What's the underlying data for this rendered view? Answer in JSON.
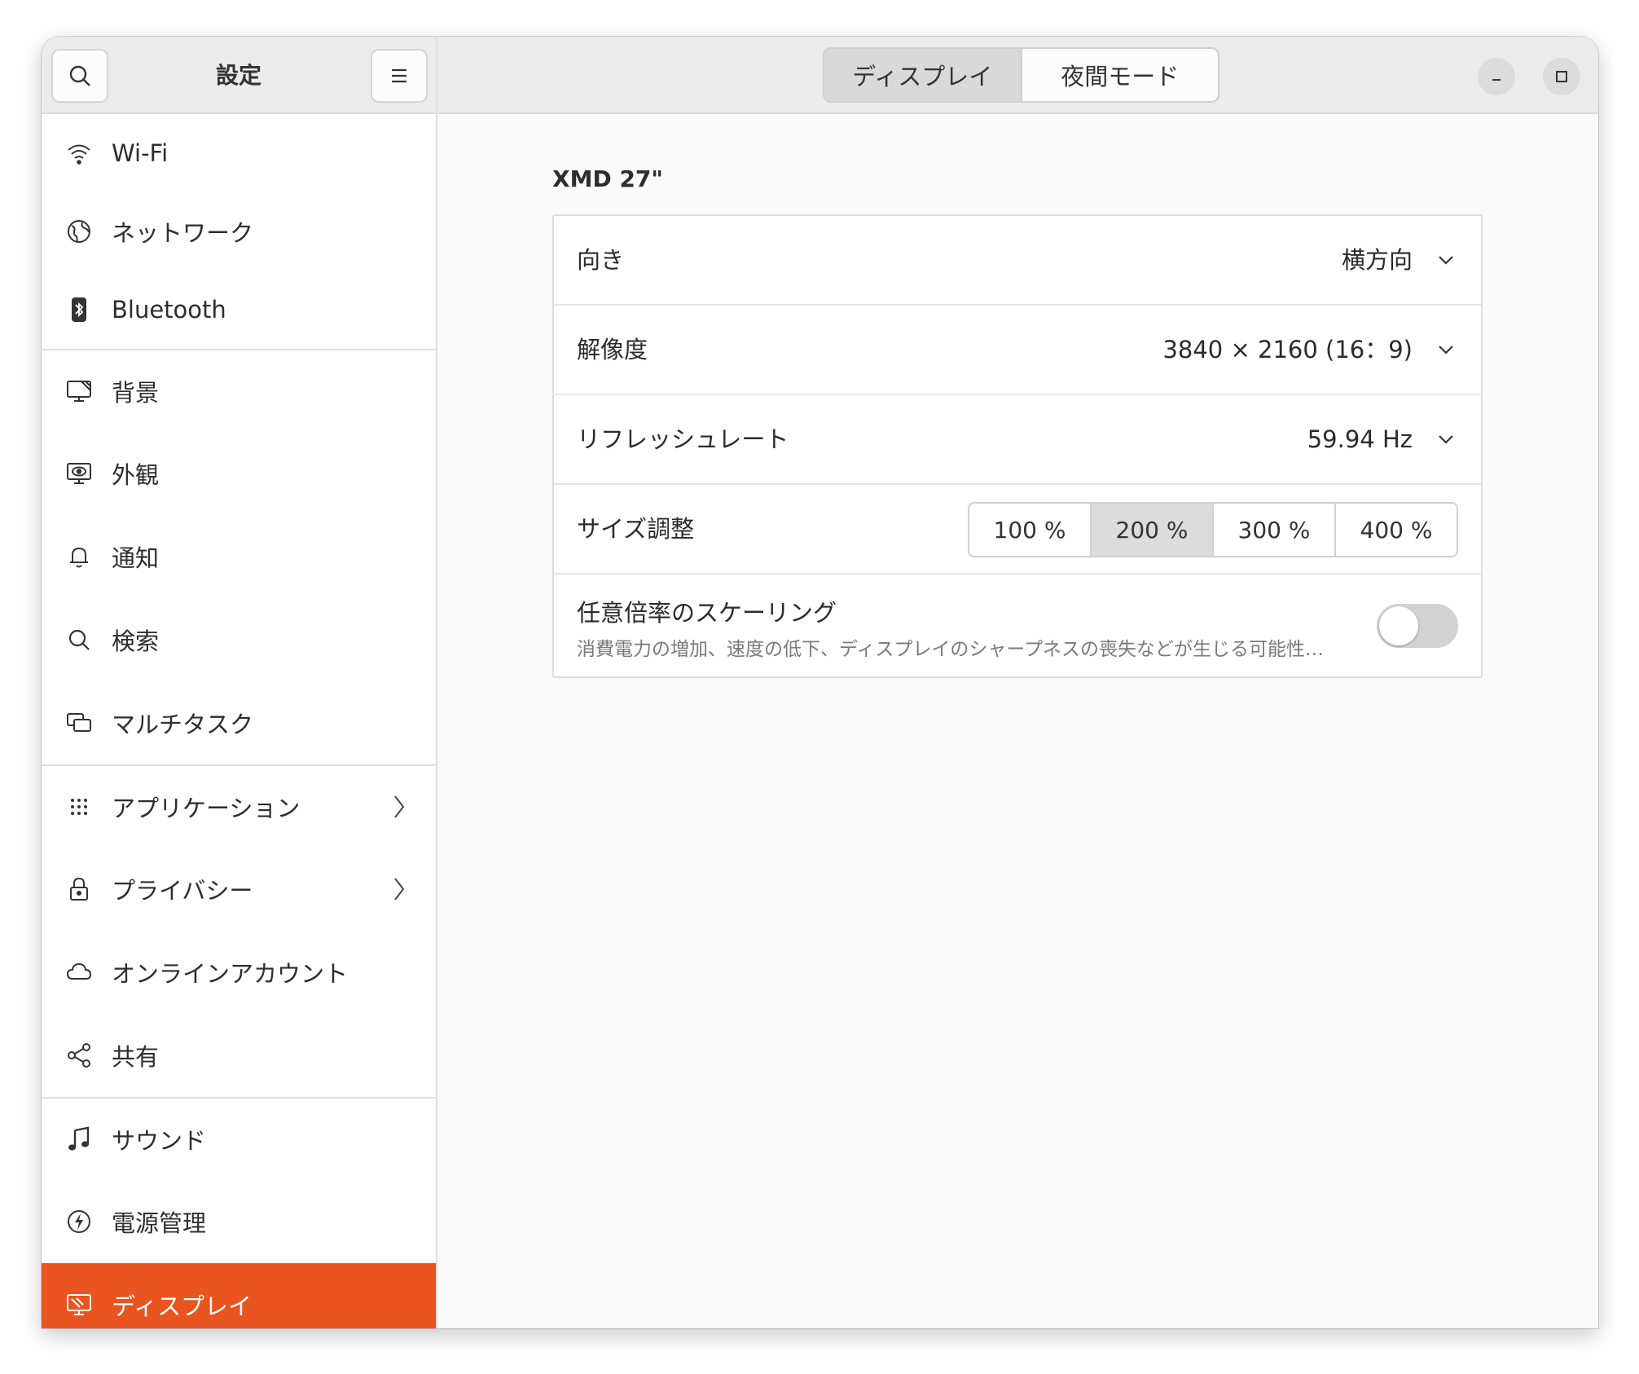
{
  "sidebar": {
    "title": "設定",
    "items": [
      {
        "label": "Wi-Fi",
        "icon": "wifi-icon"
      },
      {
        "label": "ネットワーク",
        "icon": "globe-icon"
      },
      {
        "label": "Bluetooth",
        "icon": "bluetooth-icon"
      },
      {
        "label": "背景",
        "icon": "monitor-background-icon"
      },
      {
        "label": "外観",
        "icon": "appearance-icon"
      },
      {
        "label": "通知",
        "icon": "bell-icon"
      },
      {
        "label": "検索",
        "icon": "search-icon"
      },
      {
        "label": "マルチタスク",
        "icon": "multitask-icon"
      },
      {
        "label": "アプリケーション",
        "icon": "apps-grid-icon"
      },
      {
        "label": "プライバシー",
        "icon": "lock-icon"
      },
      {
        "label": "オンラインアカウント",
        "icon": "cloud-icon"
      },
      {
        "label": "共有",
        "icon": "share-icon"
      },
      {
        "label": "サウンド",
        "icon": "music-note-icon"
      },
      {
        "label": "電源管理",
        "icon": "power-icon"
      },
      {
        "label": "ディスプレイ",
        "icon": "display-icon"
      }
    ],
    "active_item": "ディスプレイ"
  },
  "header": {
    "tabs": [
      {
        "label": "ディスプレイ",
        "active": true
      },
      {
        "label": "夜間モード",
        "active": false
      }
    ]
  },
  "display": {
    "monitor_name": "XMD 27\"",
    "orientation": {
      "label": "向き",
      "value": "横方向"
    },
    "resolution": {
      "label": "解像度",
      "value": "3840 × 2160 (16：9)"
    },
    "refresh_rate": {
      "label": "リフレッシュレート",
      "value": "59.94 Hz"
    },
    "scale": {
      "label": "サイズ調整",
      "options": [
        "100 %",
        "200 %",
        "300 %",
        "400 %"
      ],
      "selected": "200 %"
    },
    "fractional_scaling": {
      "title": "任意倍率のスケーリング",
      "subtitle": "消費電力の増加、速度の低下、ディスプレイのシャープネスの喪失などが生じる可能性…",
      "enabled": false
    }
  },
  "colors": {
    "accent": "#e95420",
    "header_bg": "#ebebeb",
    "content_bg": "#fafafa"
  }
}
